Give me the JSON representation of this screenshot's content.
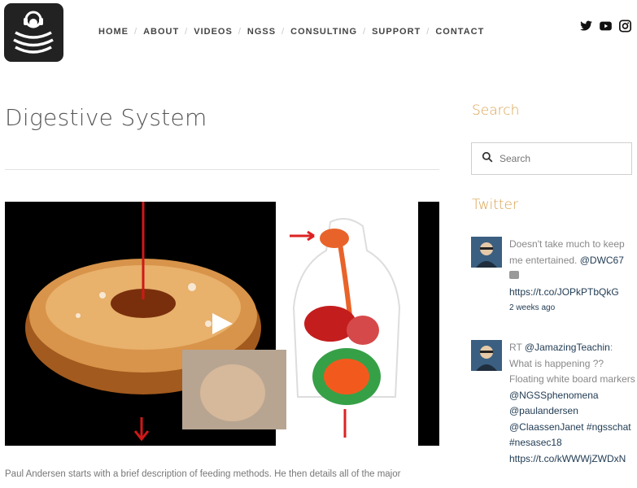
{
  "nav": {
    "items": [
      {
        "label": "HOME"
      },
      {
        "label": "ABOUT"
      },
      {
        "label": "VIDEOS"
      },
      {
        "label": "NGSS"
      },
      {
        "label": "CONSULTING"
      },
      {
        "label": "SUPPORT"
      },
      {
        "label": "CONTACT"
      }
    ],
    "separator": "/"
  },
  "social": [
    "twitter-icon",
    "youtube-icon",
    "instagram-icon"
  ],
  "page": {
    "title": "Digestive System",
    "description": "Paul Andersen starts with a brief description of feeding methods. He then details all of the major"
  },
  "sidebar": {
    "search_heading": "Search",
    "search_placeholder": "Search",
    "twitter_heading": "Twitter",
    "tweets": [
      {
        "text": "Doesn't take much to keep me entertained. ",
        "mention": "@DWC67",
        "link": "https://t.co/JOPkPTbQkG",
        "time": "2 weeks ago"
      },
      {
        "prefix": "RT ",
        "mention": "@JamazingTeachin",
        "text": ": What is happening ?? Floating white board markers ",
        "mentions2": "@NGSSphenomena @paulandersen @ClaassenJanet #ngsschat #nesasec18",
        "link": "https://t.co/kWWWjZWDxN"
      }
    ]
  },
  "colors": {
    "accent": "#d9a04e",
    "link": "#1f3a52",
    "logo_bg": "#222222"
  }
}
